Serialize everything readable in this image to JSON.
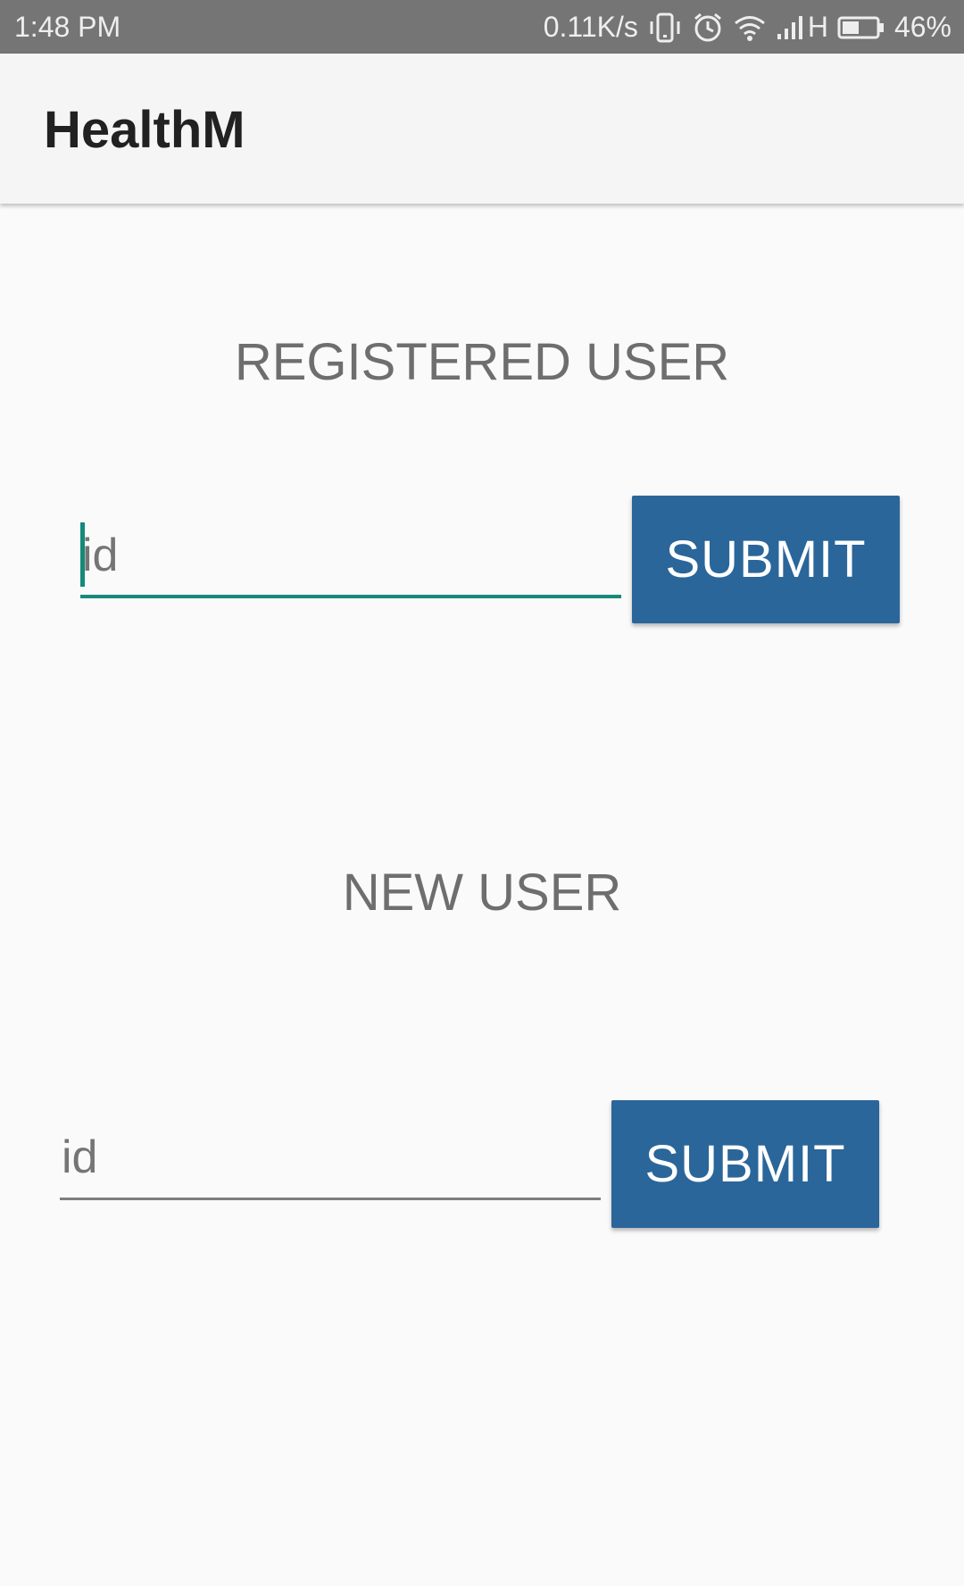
{
  "status_bar": {
    "time": "1:48 PM",
    "network_speed": "0.11K/s",
    "network_type": "H",
    "battery_percent": "46%",
    "icons": [
      "vibrate-icon",
      "alarm-icon",
      "wifi-icon",
      "signal-icon",
      "battery-icon"
    ]
  },
  "app_bar": {
    "title": "HealthM"
  },
  "registered": {
    "heading": "REGISTERED USER",
    "input_placeholder": "id",
    "input_value": "",
    "submit_label": "SUBMIT"
  },
  "new_user": {
    "heading": "NEW USER",
    "input_placeholder": "id",
    "input_value": "",
    "submit_label": "SUBMIT"
  },
  "colors": {
    "accent": "#16897a",
    "button": "#2a6699",
    "status_bar": "#757575",
    "app_bar": "#f5f5f5",
    "background": "#fafafa"
  }
}
